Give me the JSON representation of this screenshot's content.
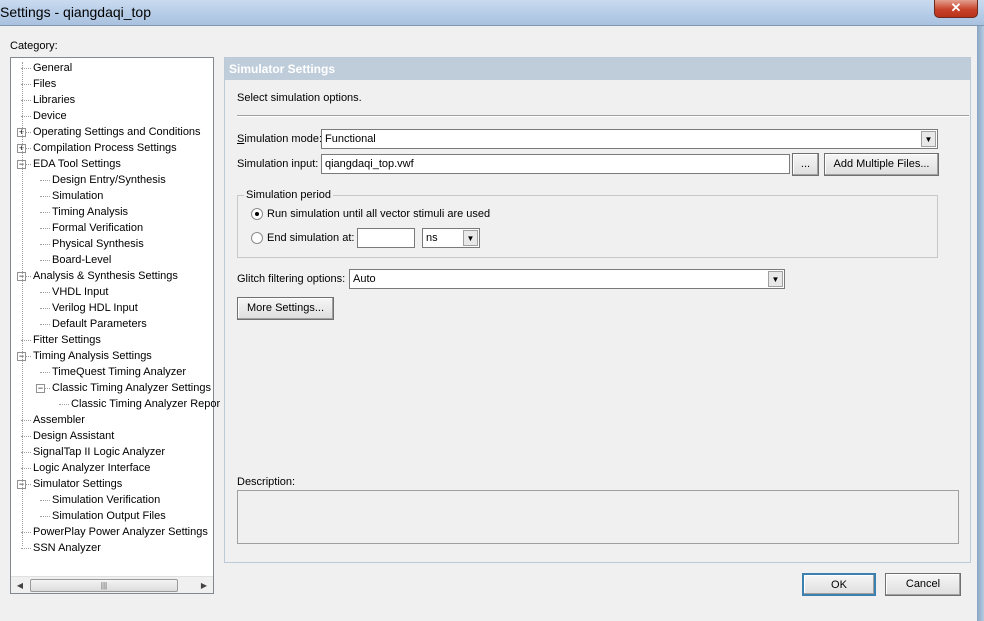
{
  "window": {
    "title": "Settings - qiangdaqi_top",
    "close_icon": "close-icon"
  },
  "category_label": "Category:",
  "tree": [
    {
      "label": "General",
      "level": 0
    },
    {
      "label": "Files",
      "level": 0
    },
    {
      "label": "Libraries",
      "level": 0
    },
    {
      "label": "Device",
      "level": 0
    },
    {
      "label": "Operating Settings and Conditions",
      "level": 0,
      "expander": "+"
    },
    {
      "label": "Compilation Process Settings",
      "level": 0,
      "expander": "+"
    },
    {
      "label": "EDA Tool Settings",
      "level": 0,
      "expander": "-"
    },
    {
      "label": "Design Entry/Synthesis",
      "level": 1
    },
    {
      "label": "Simulation",
      "level": 1
    },
    {
      "label": "Timing Analysis",
      "level": 1
    },
    {
      "label": "Formal Verification",
      "level": 1
    },
    {
      "label": "Physical Synthesis",
      "level": 1
    },
    {
      "label": "Board-Level",
      "level": 1
    },
    {
      "label": "Analysis & Synthesis Settings",
      "level": 0,
      "expander": "-"
    },
    {
      "label": "VHDL Input",
      "level": 1
    },
    {
      "label": "Verilog HDL Input",
      "level": 1
    },
    {
      "label": "Default Parameters",
      "level": 1
    },
    {
      "label": "Fitter Settings",
      "level": 0
    },
    {
      "label": "Timing Analysis Settings",
      "level": 0,
      "expander": "-"
    },
    {
      "label": "TimeQuest Timing Analyzer",
      "level": 1
    },
    {
      "label": "Classic Timing Analyzer Settings",
      "level": 1,
      "expander": "-"
    },
    {
      "label": "Classic Timing Analyzer Repor",
      "level": 2
    },
    {
      "label": "Assembler",
      "level": 0
    },
    {
      "label": "Design Assistant",
      "level": 0
    },
    {
      "label": "SignalTap II Logic Analyzer",
      "level": 0
    },
    {
      "label": "Logic Analyzer Interface",
      "level": 0
    },
    {
      "label": "Simulator Settings",
      "level": 0,
      "expander": "-"
    },
    {
      "label": "Simulation Verification",
      "level": 1
    },
    {
      "label": "Simulation Output Files",
      "level": 1
    },
    {
      "label": "PowerPlay Power Analyzer Settings",
      "level": 0
    },
    {
      "label": "SSN Analyzer",
      "level": 0
    }
  ],
  "panel": {
    "header": "Simulator Settings",
    "intro": "Select simulation options.",
    "mode_label": "Simulation mode:",
    "mode_value": "Functional",
    "input_label": "Simulation input:",
    "input_value": "qiangdaqi_top.vwf",
    "browse_label": "...",
    "add_files_label": "Add Multiple Files...",
    "period_label": "Simulation period",
    "radio_run_label": "Run simulation until all vector stimuli are used",
    "radio_end_label": "End simulation at:",
    "end_value": "",
    "unit_value": "ns",
    "glitch_label": "Glitch filtering options:",
    "glitch_value": "Auto",
    "more_settings_label": "More Settings...",
    "description_label": "Description:",
    "description_value": ""
  },
  "buttons": {
    "ok": "OK",
    "cancel": "Cancel"
  }
}
